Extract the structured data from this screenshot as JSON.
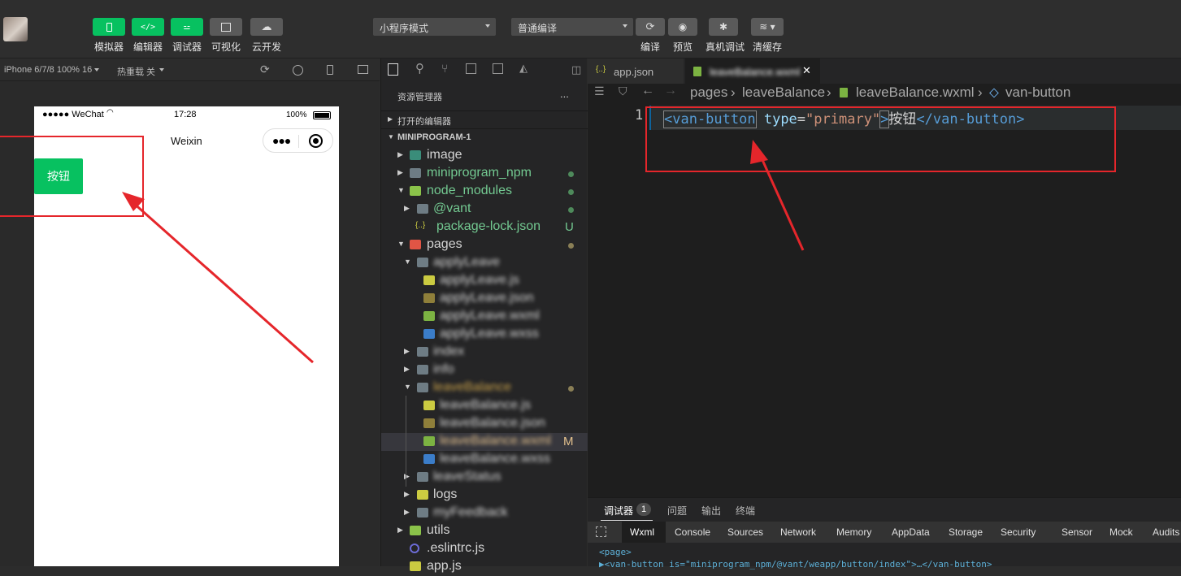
{
  "toolbar": {
    "buttons": [
      {
        "label": "模拟器",
        "icon": "phone-icon"
      },
      {
        "label": "编辑器",
        "icon": "code-icon"
      },
      {
        "label": "调试器",
        "icon": "sliders-icon"
      },
      {
        "label": "可视化",
        "icon": "layout-icon"
      },
      {
        "label": "云开发",
        "icon": "cloud-icon"
      }
    ],
    "mode_select": "小程序模式",
    "compile_select": "普通编译",
    "right_buttons": [
      {
        "label": "编译",
        "icon": "refresh-icon"
      },
      {
        "label": "预览",
        "icon": "eye-icon"
      },
      {
        "label": "真机调试",
        "icon": "bug-icon"
      },
      {
        "label": "清缓存",
        "icon": "layers-icon"
      }
    ]
  },
  "simulator": {
    "device": "iPhone 6/7/8 100% 16",
    "hot_reload": "热重载 关",
    "status": {
      "carrier": "●●●●● WeChat",
      "time": "17:28",
      "battery": "100%"
    },
    "nav_title": "Weixin",
    "button_text": "按钮"
  },
  "explorer": {
    "title": "资源管理器",
    "more": "...",
    "open_editors": "打开的编辑器",
    "project": "MINIPROGRAM-1",
    "items": [
      {
        "name": "image",
        "blurred": false
      },
      {
        "name": "miniprogram_npm",
        "blurred": false
      },
      {
        "name": "node_modules",
        "blurred": false
      },
      {
        "name": "@vant",
        "blurred": false
      },
      {
        "name": "package-lock.json",
        "blurred": false,
        "badge": "U"
      },
      {
        "name": "pages",
        "blurred": false
      },
      {
        "name": "applyLeave",
        "blurred": true
      },
      {
        "name": "applyLeave.js",
        "blurred": true
      },
      {
        "name": "applyLeave.json",
        "blurred": true
      },
      {
        "name": "applyLeave.wxml",
        "blurred": true
      },
      {
        "name": "applyLeave.wxss",
        "blurred": true
      },
      {
        "name": "index",
        "blurred": true
      },
      {
        "name": "info",
        "blurred": true
      },
      {
        "name": "leaveBalance",
        "blurred": true
      },
      {
        "name": "leaveBalance.js",
        "blurred": true
      },
      {
        "name": "leaveBalance.json",
        "blurred": true
      },
      {
        "name": "leaveBalance.wxml",
        "blurred": true,
        "badge": "M"
      },
      {
        "name": "leaveBalance.wxss",
        "blurred": true
      },
      {
        "name": "leaveStatus",
        "blurred": true
      },
      {
        "name": "logs",
        "blurred": false
      },
      {
        "name": "myFeedback",
        "blurred": true
      },
      {
        "name": "utils",
        "blurred": false
      },
      {
        "name": ".eslintrc.js",
        "blurred": false
      },
      {
        "name": "app.js",
        "blurred": false
      }
    ]
  },
  "editor": {
    "tabs": [
      {
        "label": "app.json",
        "icon": "{..}"
      },
      {
        "label": "leaveBalance.wxml",
        "close": "✕"
      }
    ],
    "breadcrumb": [
      "pages",
      "leaveBalance",
      "leaveBalance.wxml",
      "van-button"
    ],
    "line_number": "1",
    "code": {
      "open_tag": "<van-button",
      "attr": "type",
      "eq": "=",
      "value": "\"primary\"",
      "close_bracket": ">",
      "text": "按钮",
      "end_tag": "</van-button>"
    }
  },
  "devtools": {
    "tabs": [
      "调试器",
      "问题",
      "输出",
      "终端"
    ],
    "badge": "1",
    "panels": [
      "Wxml",
      "Console",
      "Sources",
      "Network",
      "Memory",
      "AppData",
      "Storage",
      "Security",
      "Sensor",
      "Mock",
      "Audits"
    ],
    "dom_line1": "<page>",
    "dom_line2": "▶<van-button is=\"miniprogram_npm/@vant/weapp/button/index\">…</van-button>"
  },
  "colors": {
    "accent": "#07c160",
    "annotation_red": "#e5262b",
    "tag": "#569cd6",
    "attr": "#9cdcfe",
    "string": "#ce9178"
  }
}
